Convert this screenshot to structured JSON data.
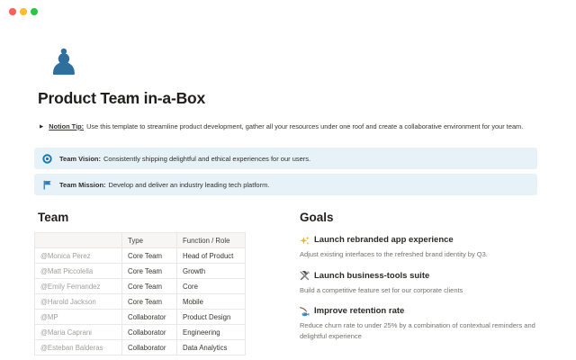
{
  "window": {
    "traffic_lights": {
      "close": "#ff5f57",
      "minimize": "#febc2e",
      "zoom": "#28c840"
    }
  },
  "page": {
    "icon_glyph": "♟",
    "title": "Product Team in-a-Box",
    "tip": {
      "toggle_glyph": "▶",
      "label": "Notion Tip:",
      "text": "Use this template to streamline product development, gather all your resources under one roof and create a collaborative environment for your team."
    },
    "callouts": [
      {
        "icon": "target-icon",
        "label": "Team Vision:",
        "text": "Consistently shipping delightful and ethical experiences for our users."
      },
      {
        "icon": "flag-icon",
        "label": "Team Mission:",
        "text": "Develop and deliver an industry leading tech platform."
      }
    ]
  },
  "team": {
    "heading": "Team",
    "table": {
      "headers": [
        "",
        "Type",
        "Function / Role"
      ],
      "rows": [
        [
          "@Monica Perez",
          "Core Team",
          "Head of Product"
        ],
        [
          "@Matt Piccolella",
          "Core Team",
          "Growth"
        ],
        [
          "@Emily Fernandez",
          "Core Team",
          "Core"
        ],
        [
          "@Harold Jackson",
          "Core Team",
          "Mobile"
        ],
        [
          "@MP",
          "Collaborator",
          "Product Design"
        ],
        [
          "@Maria Caprani",
          "Collaborator",
          "Engineering"
        ],
        [
          "@Esteban Balderas",
          "Collaborator",
          "Data Analytics"
        ]
      ]
    }
  },
  "goals": {
    "heading": "Goals",
    "items": [
      {
        "icon": "sparkles-icon",
        "title": "Launch rebranded app experience",
        "description": "Adjust existing interfaces to the refreshed brand identity by Q3."
      },
      {
        "icon": "tools-icon",
        "title": "Launch business-tools suite",
        "description": "Build a competitive feature set for our corporate clients"
      },
      {
        "icon": "fishing-icon",
        "title": "Improve retention rate",
        "description": "Reduce churn rate to under 25% by a combination of contextual reminders and delightful experience"
      }
    ]
  },
  "colors": {
    "accent_blue": "#2e6f9e",
    "callout_bg": "#e7f2f8",
    "table_border": "#e9e8e6",
    "table_header_bg": "#f7f6f4",
    "muted_text": "#73726e",
    "mention_text": "#9f9e9b"
  }
}
